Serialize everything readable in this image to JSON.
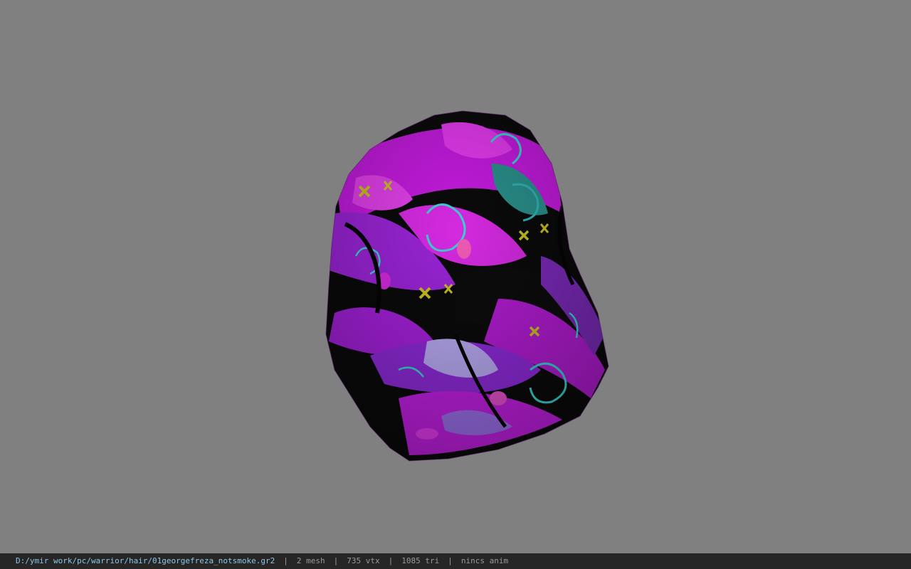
{
  "viewer": {
    "background_color": "#808080",
    "model": {
      "icon": "helmet-mesh",
      "texture_colors": {
        "base": "#0a0a0a",
        "magenta": "#d21ee6",
        "violet": "#8a2cd8",
        "cyan": "#36c6c8",
        "yellow": "#c8c020",
        "pink": "#f05ab4"
      }
    }
  },
  "status_bar": {
    "file_path": "D:/ymir work/pc/warrior/hair/01georgefreza_notsmoke.gr2",
    "separator": "|",
    "mesh_count": "2 mesh",
    "vertex_count": "735 vtx",
    "triangle_count": "1085 tri",
    "anim_label": "nincs anim",
    "path_color": "#8fc6e6",
    "background_color": "#262626"
  }
}
